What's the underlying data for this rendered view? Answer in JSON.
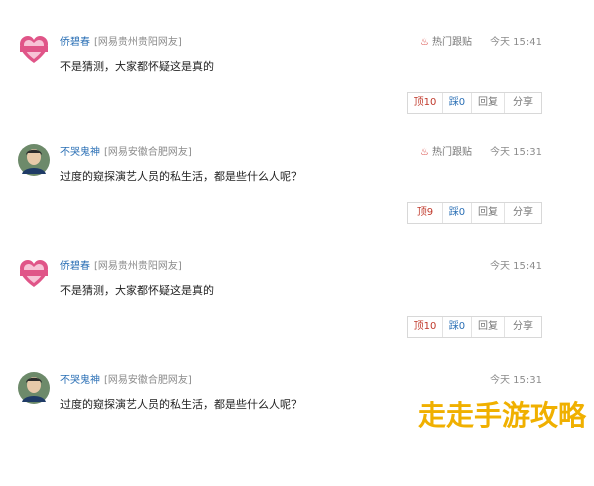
{
  "comments": [
    {
      "avatar": "heart-avatar-icon",
      "user": "侨碧春",
      "location": "[网易贵州贵阳网友]",
      "hot_label": "热门跟贴",
      "time": "今天 15:41",
      "text": "不是猜测，大家都怀疑这是真的",
      "up": "顶10",
      "down": "踩0",
      "reply": "回复",
      "share": "分享"
    },
    {
      "avatar": "person-avatar-icon",
      "user": "不哭鬼神",
      "location": "[网易安徽合肥网友]",
      "hot_label": "热门跟贴",
      "time": "今天 15:31",
      "text": "过度的窥探演艺人员的私生活，都是些什么人呢？",
      "up": "顶9",
      "down": "踩0",
      "reply": "回复",
      "share": "分享"
    },
    {
      "avatar": "heart-avatar-icon",
      "user": "侨碧春",
      "location": "[网易贵州贵阳网友]",
      "hot_label": "",
      "time": "今天 15:41",
      "text": "不是猜测，大家都怀疑这是真的",
      "up": "顶10",
      "down": "踩0",
      "reply": "回复",
      "share": "分享"
    },
    {
      "avatar": "person-avatar-icon",
      "user": "不哭鬼神",
      "location": "[网易安徽合肥网友]",
      "hot_label": "",
      "time": "今天 15:31",
      "text": "过度的窥探演艺人员的私生活，都是些什么人呢？",
      "up": "",
      "down": "",
      "reply": "",
      "share": ""
    }
  ],
  "watermark": "走走手游攻略",
  "colors": {
    "username": "#2a6fb5",
    "up": "#c0392b",
    "flame": "#d2302a",
    "watermark": "#f0b000"
  }
}
